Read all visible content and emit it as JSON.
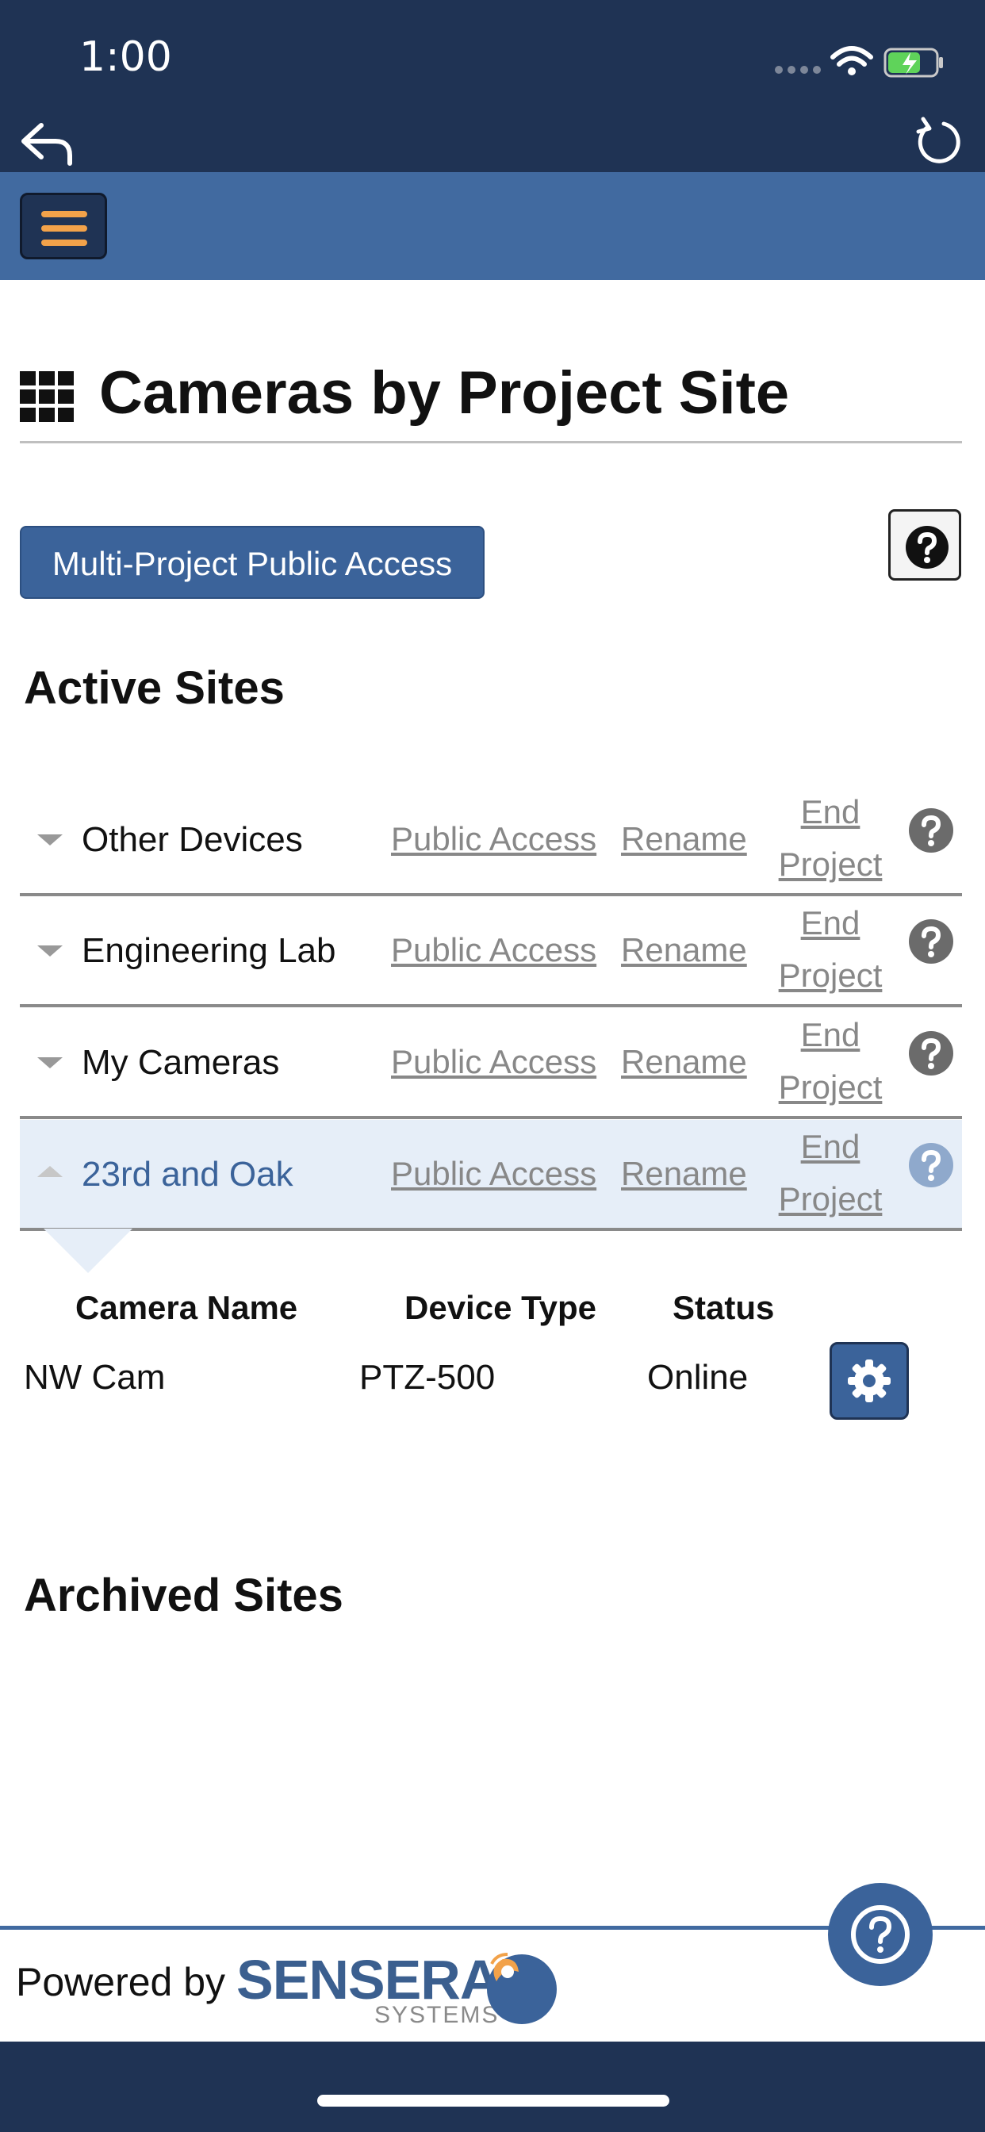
{
  "status_bar": {
    "time": "1:00"
  },
  "colors": {
    "nav_dark": "#1f3354",
    "nav_blue": "#416aa0",
    "accent": "#3b639a",
    "menu_orange": "#f2a24a",
    "link_gray": "#888888",
    "expanded_bg": "#e6eef8"
  },
  "page": {
    "title": "Cameras by Project Site",
    "multi_project_button": "Multi-Project Public Access",
    "active_heading": "Active Sites",
    "archived_heading": "Archived Sites"
  },
  "row_links": {
    "public_access": "Public Access",
    "rename": "Rename",
    "end_line1": "End",
    "end_line2": "Project"
  },
  "sites": [
    {
      "name": "Other Devices",
      "expanded": false
    },
    {
      "name": "Engineering Lab",
      "expanded": false
    },
    {
      "name": "My Cameras",
      "expanded": false
    },
    {
      "name": "23rd and Oak",
      "expanded": true
    }
  ],
  "cameras_table": {
    "headers": [
      "Camera Name",
      "Device Type",
      "Status"
    ],
    "rows": [
      {
        "name": "NW Cam",
        "type": "PTZ-500",
        "status": "Online"
      }
    ]
  },
  "footer": {
    "powered_by": "Powered by",
    "logo_main": "SENSERA",
    "logo_sub": "SYSTEMS"
  },
  "icons": [
    "back-arrow-icon",
    "refresh-icon",
    "hamburger-menu-icon",
    "grid-icon",
    "help-icon",
    "question-circle-icon",
    "gear-icon",
    "caret-down-icon",
    "caret-up-icon",
    "wifi-icon",
    "battery-icon"
  ]
}
